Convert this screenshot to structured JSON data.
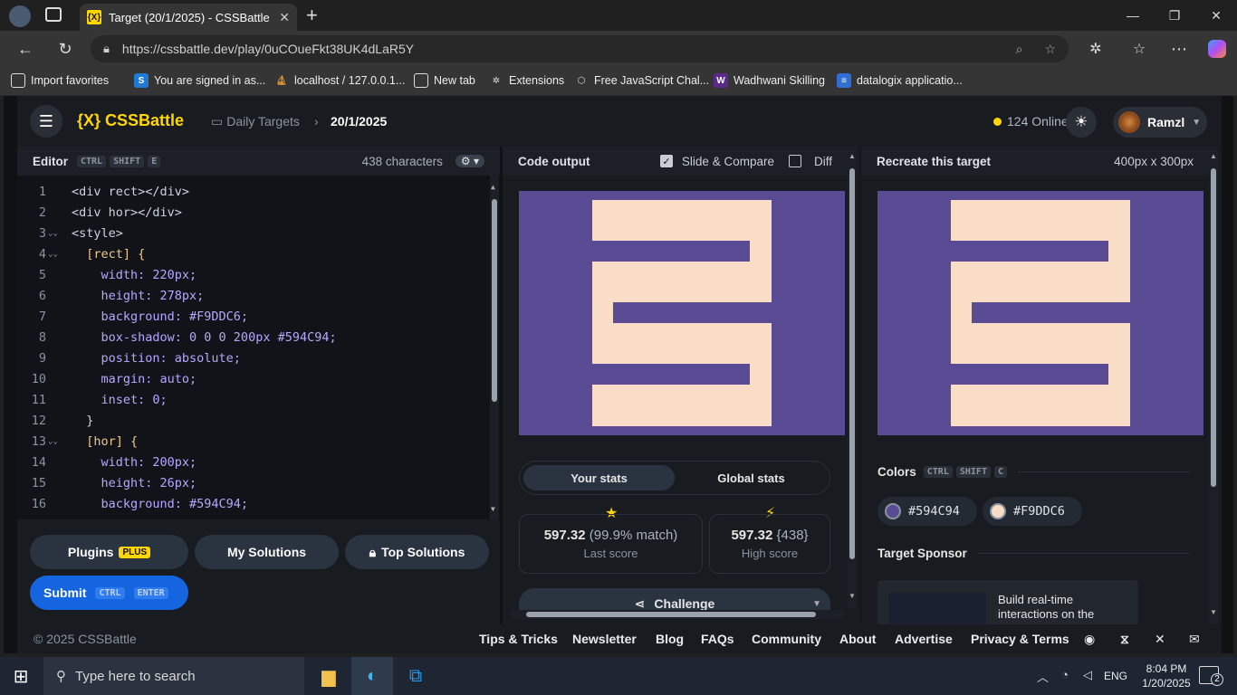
{
  "browser": {
    "tab_title": "Target (20/1/2025) - CSSBattle",
    "url": "https://cssbattle.dev/play/0uCOueFkt38UK4dLaR5Y",
    "favorites": [
      {
        "label": "Import favorites",
        "icon": "import-icon"
      },
      {
        "label": "You are signed in as...",
        "icon": "s-icon"
      },
      {
        "label": "localhost / 127.0.0.1...",
        "icon": "sail-icon"
      },
      {
        "label": "New tab",
        "icon": "newtab-icon"
      },
      {
        "label": "Extensions",
        "icon": "puzzle-icon"
      },
      {
        "label": "Free JavaScript Chal...",
        "icon": "cube-icon"
      },
      {
        "label": "Wadhwani Skilling",
        "icon": "w-icon"
      },
      {
        "label": "datalogix applicatio...",
        "icon": "doc-icon"
      }
    ]
  },
  "app": {
    "logo": "{X} CSSBattle",
    "breadcrumb_1": "Daily Targets",
    "breadcrumb_2": "20/1/2025",
    "online": "124 Online",
    "user": "Ramzl"
  },
  "editor": {
    "title": "Editor",
    "shortcut": [
      "CTRL",
      "SHIFT",
      "E"
    ],
    "chars": "438 characters",
    "lines": [
      {
        "n": "1",
        "text": "<div rect></div>"
      },
      {
        "n": "2",
        "text": "<div hor></div>"
      },
      {
        "n": "3",
        "text": "<style>"
      },
      {
        "n": "4",
        "text": "  [rect] {"
      },
      {
        "n": "5",
        "text": "    width: 220px;"
      },
      {
        "n": "6",
        "text": "    height: 278px;"
      },
      {
        "n": "7",
        "text": "    background: #F9DDC6;"
      },
      {
        "n": "8",
        "text": "    box-shadow: 0 0 0 200px #594C94;"
      },
      {
        "n": "9",
        "text": "    position: absolute;"
      },
      {
        "n": "10",
        "text": "    margin: auto;"
      },
      {
        "n": "11",
        "text": "    inset: 0;"
      },
      {
        "n": "12",
        "text": "  }"
      },
      {
        "n": "13",
        "text": "  [hor] {"
      },
      {
        "n": "14",
        "text": "    width: 200px;"
      },
      {
        "n": "15",
        "text": "    height: 26px;"
      },
      {
        "n": "16",
        "text": "    background: #594C94;"
      }
    ]
  },
  "buttons": {
    "plugins": "Plugins",
    "plus": "PLUS",
    "my_solutions": "My Solutions",
    "top_solutions": "Top Solutions",
    "submit": "Submit",
    "submit_keys": [
      "CTRL",
      "ENTER"
    ]
  },
  "output": {
    "title": "Code output",
    "slide_compare": "Slide & Compare",
    "diff": "Diff",
    "your_stats": "Your stats",
    "global_stats": "Global stats",
    "last_score": "597.32",
    "last_match": "(99.9% match)",
    "last_label": "Last score",
    "high_score": "597.32",
    "high_chars": "{438}",
    "high_label": "High score",
    "challenge": "Challenge"
  },
  "target": {
    "title": "Recreate this target",
    "size": "400px x 300px",
    "colors_title": "Colors",
    "colors_keys": [
      "CTRL",
      "SHIFT",
      "C"
    ],
    "colors": [
      "#594C94",
      "#F9DDC6"
    ],
    "sponsor_title": "Target Sponsor",
    "sponsor_text": "Build real-time interactions on the"
  },
  "footer": {
    "copyright": "© 2025 CSSBattle",
    "links": [
      "Tips & Tricks",
      "Newsletter",
      "Blog",
      "FAQs",
      "Community",
      "About",
      "Advertise",
      "Privacy & Terms"
    ]
  },
  "taskbar": {
    "search": "Type here to search",
    "lang": "ENG",
    "time": "8:04 PM",
    "date": "1/20/2025",
    "notif": "2"
  },
  "palette": {
    "purple": "#594C94",
    "peach": "#F9DDC6",
    "accent": "#FFD600",
    "submit": "#1565e0"
  }
}
